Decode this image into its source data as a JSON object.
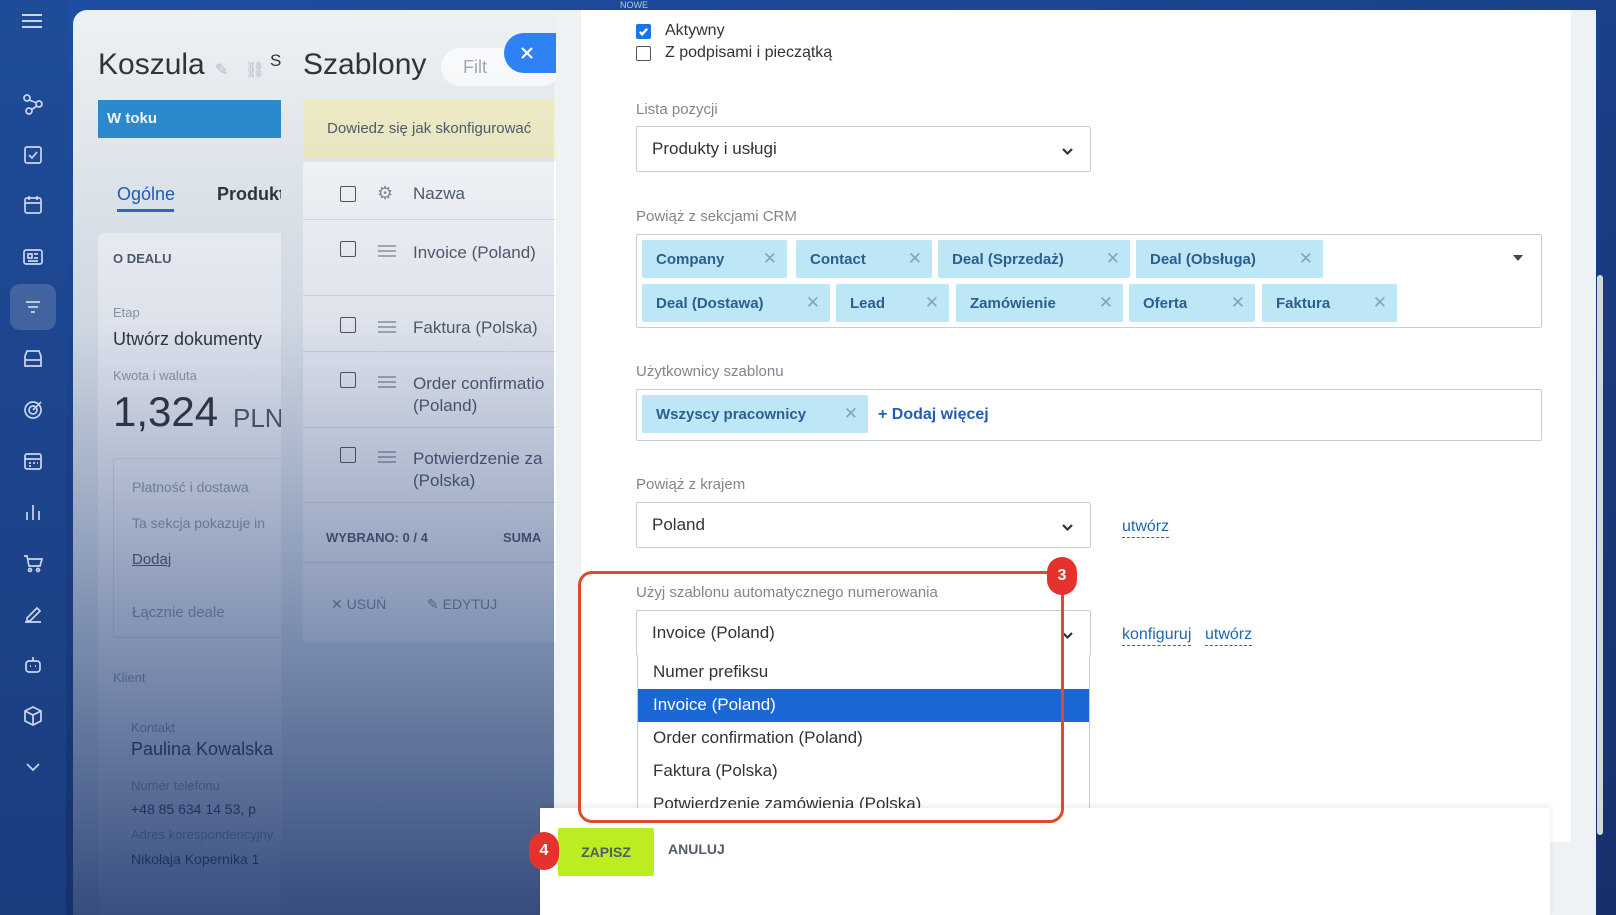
{
  "rail": {
    "icons": [
      "flow-icon",
      "tasks-icon",
      "calendar-icon",
      "news-icon",
      "crm-icon",
      "shop-icon",
      "target-icon",
      "schedule-icon",
      "analytics-icon",
      "cart-icon",
      "sign-icon",
      "robot-icon",
      "cube-icon",
      "chevron-down-icon"
    ]
  },
  "top_hint": "NOWE",
  "deal": {
    "title": "Koszula",
    "title_extra": "S",
    "stage": "W toku",
    "tabs": [
      "Ogólne",
      "Produkt"
    ],
    "section_title": "O DEALU",
    "stage_label": "Etap",
    "stage_value": "Utwórz dokumenty",
    "amount_label": "Kwota i waluta",
    "amount_value": "1,324",
    "currency": "PLN",
    "payment_label": "Płatność i dostawa",
    "payment_text": "Ta sekcja pokazuje in",
    "add_link": "Dodaj",
    "total_label": "Łącznie deale",
    "client_label": "Klient",
    "contact_label": "Kontakt",
    "contact_name": "Paulina Kowalska",
    "phone_label": "Numer telefonu",
    "phone_value": "+48 85 634 14 53, p",
    "address_label": "Adres korespondencyjny",
    "address_value": "Nikołaja Kopernika 1"
  },
  "templates": {
    "title": "Szablony",
    "filter_placeholder": "Filt",
    "hint": "Dowiedz się jak skonfigurować",
    "column_name": "Nazwa",
    "rows": [
      "Invoice (Poland)",
      "Faktura (Polska)",
      "Order confirmation (Poland)",
      "Potwierdzenie zamówienia (Polska)"
    ],
    "row2_line1": "Order confirmatio",
    "row2_line2": "(Poland)",
    "row3_line1": "Potwierdzenie za",
    "row3_line2": "(Polska)",
    "selected": "WYBRANO: 0 / 4",
    "sum": "SUMA",
    "delete": "USUŃ",
    "edit": "EDYTUJ"
  },
  "form": {
    "active_label": "Aktywny",
    "active_checked": true,
    "signatures_label": "Z podpisami i pieczątką",
    "signatures_checked": false,
    "items_list_label": "Lista pozycji",
    "items_list_value": "Produkty i usługi",
    "crm_label": "Powiąż z sekcjami CRM",
    "crm_tags": [
      "Company",
      "Contact",
      "Deal (Sprzedaż)",
      "Deal (Obsługa)",
      "Deal (Dostawa)",
      "Lead",
      "Zamówienie",
      "Oferta",
      "Faktura"
    ],
    "users_label": "Użytkownicy szablonu",
    "users_tags": [
      "Wszyscy pracownicy"
    ],
    "users_add": "+ Dodaj więcej",
    "country_label": "Powiąż z krajem",
    "country_value": "Poland",
    "country_create": "utwórz",
    "numbering_label": "Użyj szablonu automatycznego numerowania",
    "numbering_value": "Invoice (Poland)",
    "numbering_configure": "konfiguruj",
    "numbering_create": "utwórz",
    "numbering_options": [
      "Numer prefiksu",
      "Invoice (Poland)",
      "Order confirmation (Poland)",
      "Faktura (Polska)",
      "Potwierdzenie zamówienia (Polska)"
    ],
    "numbering_selected_index": 1
  },
  "footer": {
    "save": "ZAPISZ",
    "cancel": "ANULUJ"
  },
  "annotations": {
    "step3": "3",
    "step4": "4",
    "highlight_color": "#e04a2c"
  }
}
